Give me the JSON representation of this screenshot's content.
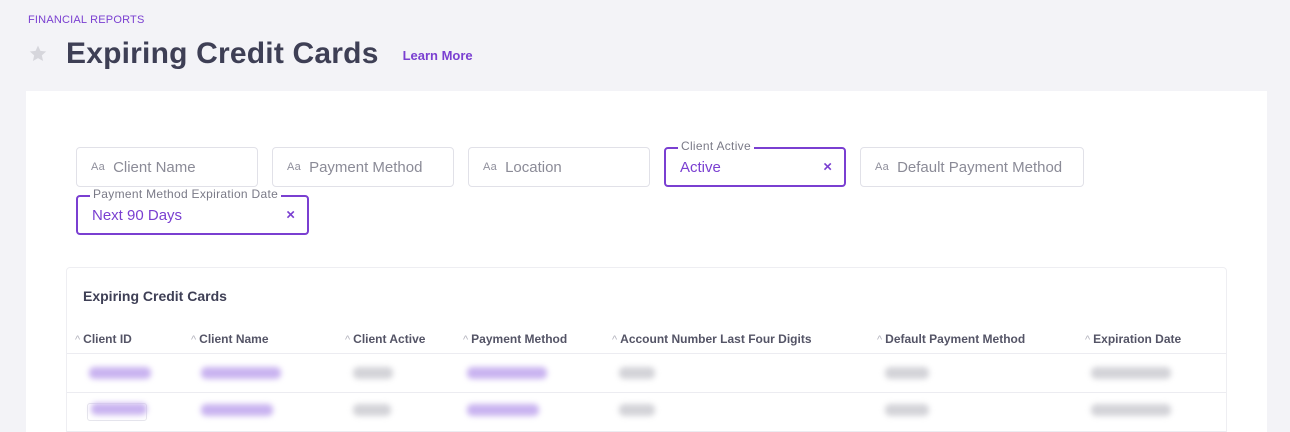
{
  "header": {
    "breadcrumb": "FINANCIAL REPORTS",
    "title": "Expiring Credit Cards",
    "learn_more": "Learn More",
    "star_icon": "star-icon"
  },
  "filters": {
    "client_name": {
      "prefix": "Aa",
      "placeholder": "Client Name"
    },
    "payment_method": {
      "prefix": "Aa",
      "placeholder": "Payment Method"
    },
    "location": {
      "prefix": "Aa",
      "placeholder": "Location"
    },
    "client_active": {
      "label": "Client Active",
      "value": "Active",
      "clear": "×"
    },
    "default_payment_method": {
      "prefix": "Aa",
      "placeholder": "Default Payment Method"
    },
    "expiration_date": {
      "label": "Payment Method Expiration Date",
      "value": "Next 90 Days",
      "clear": "×"
    }
  },
  "table": {
    "title": "Expiring Credit Cards",
    "sort_glyph": "^",
    "columns": [
      "Client ID",
      "Client Name",
      "Client Active",
      "Payment Method",
      "Account Number Last Four Digits",
      "Default Payment Method",
      "Expiration Date"
    ]
  },
  "colors": {
    "accent": "#7a3fd1",
    "background": "#f3f3f7",
    "title_text": "#3e3f55"
  }
}
